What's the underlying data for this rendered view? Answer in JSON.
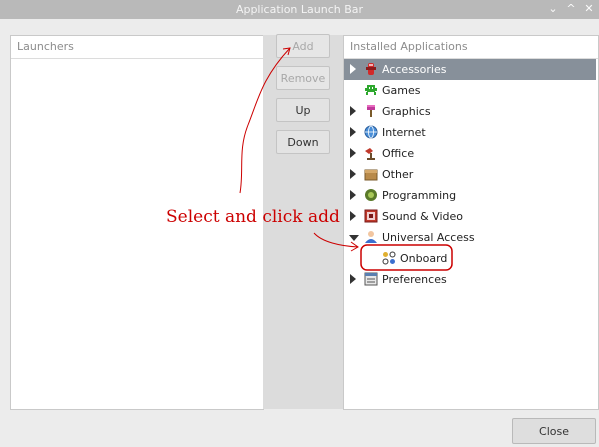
{
  "window": {
    "title": "Application Launch Bar",
    "controls": {
      "minimize": "⌄",
      "maximize": "^",
      "close": "✕"
    }
  },
  "launchers": {
    "header": "Launchers",
    "items": []
  },
  "installed": {
    "header": "Installed Applications",
    "items": [
      {
        "label": "Accessories",
        "icon": "accessories-icon",
        "expander": "collapsed",
        "selected": true
      },
      {
        "label": "Games",
        "icon": "games-icon",
        "expander": "none"
      },
      {
        "label": "Graphics",
        "icon": "graphics-icon",
        "expander": "collapsed"
      },
      {
        "label": "Internet",
        "icon": "internet-icon",
        "expander": "collapsed"
      },
      {
        "label": "Office",
        "icon": "office-icon",
        "expander": "collapsed"
      },
      {
        "label": "Other",
        "icon": "other-icon",
        "expander": "collapsed"
      },
      {
        "label": "Programming",
        "icon": "programming-icon",
        "expander": "collapsed"
      },
      {
        "label": "Sound & Video",
        "icon": "sound-video-icon",
        "expander": "collapsed"
      },
      {
        "label": "Universal Access",
        "icon": "universal-access-icon",
        "expander": "expanded"
      },
      {
        "label": "Onboard",
        "icon": "onboard-icon",
        "expander": "none",
        "child": true
      },
      {
        "label": "Preferences",
        "icon": "preferences-icon",
        "expander": "collapsed"
      }
    ]
  },
  "buttons": {
    "add": "Add",
    "remove": "Remove",
    "up": "Up",
    "down": "Down",
    "close": "Close"
  },
  "annotation": {
    "text": "Select and click add",
    "color": "#cc0000"
  },
  "colors": {
    "titlebar": "#b9b9b9",
    "selection": "#87909a"
  }
}
